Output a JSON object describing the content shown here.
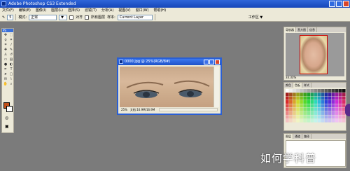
{
  "app": {
    "title": "Adobe Photoshop CS3 Extended"
  },
  "menu": [
    "文件(F)",
    "编辑(E)",
    "图像(I)",
    "图层(L)",
    "选择(S)",
    "滤镜(T)",
    "分析(A)",
    "视图(V)",
    "窗口(W)",
    "帮助(H)"
  ],
  "options_bar": {
    "size_label": "5",
    "mode_label": "模式:",
    "mode_value": "正常",
    "fill_value": "▼",
    "check_align": "对齐",
    "check_all_layers": "所有图层",
    "sample_label": "样本:",
    "sample_value": "Current Layer",
    "workspace_label": "工作区 ▼"
  },
  "toolbox": {
    "header": "PS"
  },
  "document": {
    "title": "0000.jpg @ 25%(RGB/8#)",
    "zoom": "25%",
    "doc_size": "文档:16.9M/16.9M"
  },
  "navigator": {
    "tabs": [
      "导航器",
      "直方图",
      "信息"
    ],
    "zoom": "33.33%"
  },
  "color_panel": {
    "tabs": [
      "颜色",
      "色板",
      "样式"
    ]
  },
  "layers_panel": {
    "tabs": [
      "图层",
      "通道",
      "路径"
    ]
  },
  "watermark": {
    "text": "如何学科普"
  },
  "colors": {
    "foreground": "#c0501a",
    "background": "#ffffff"
  }
}
